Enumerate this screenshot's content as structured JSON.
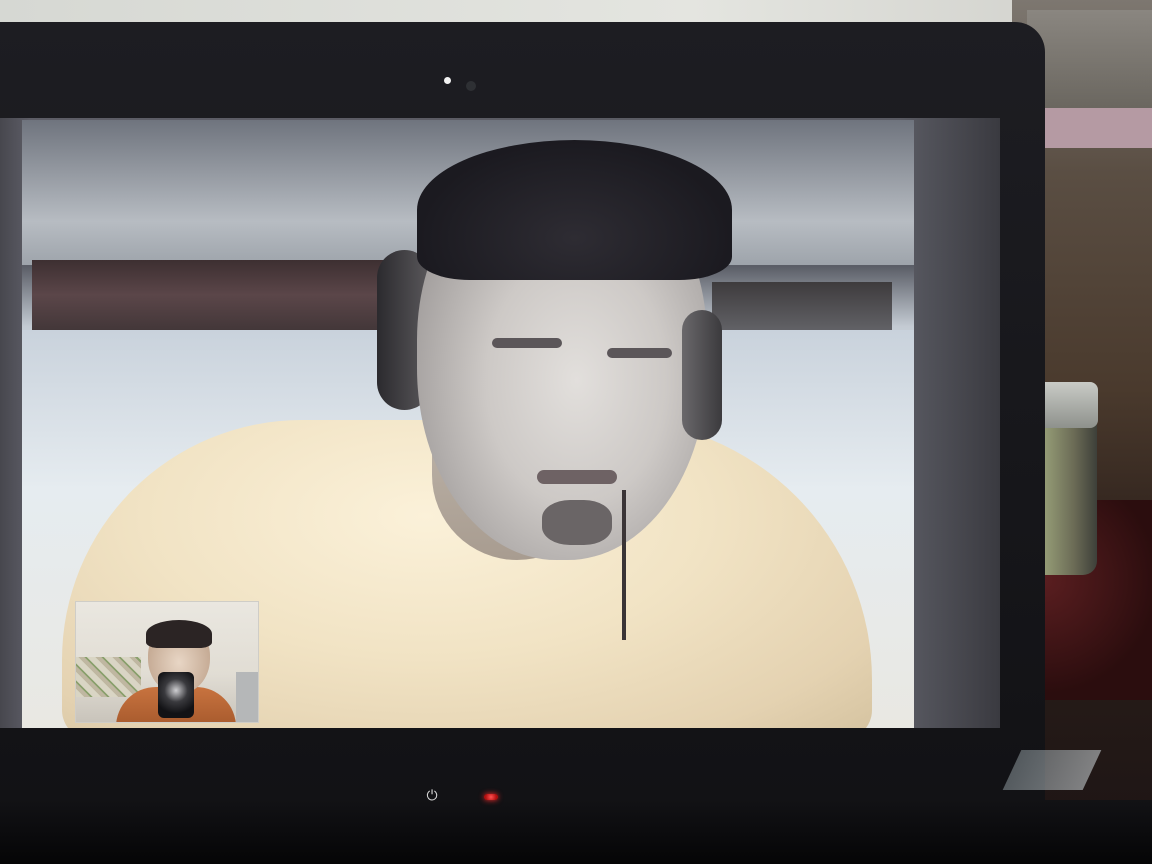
{
  "scene": {
    "description_type": "photo",
    "colors": {
      "bezel": "#1b1b1f",
      "shirt": "#f1e3c4",
      "led": "#ff5151",
      "selfview_shirt": "#c8733f"
    }
  },
  "call": {
    "remote_video": {},
    "self_view": {}
  },
  "indicators": {
    "power_icon": "⏻"
  }
}
